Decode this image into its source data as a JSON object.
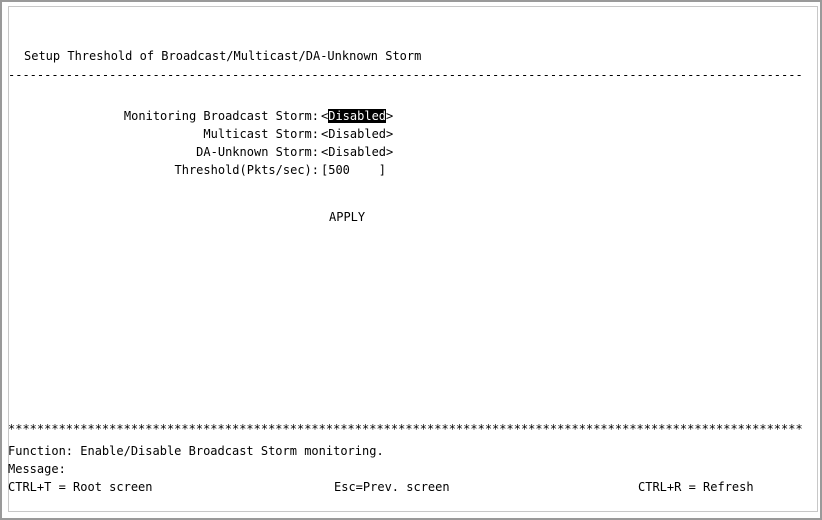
{
  "header": {
    "title": "Setup Threshold of Broadcast/Multicast/DA-Unknown Storm",
    "rule_top": "--------------------------------------------------------------------------------------------------------------"
  },
  "form": {
    "broadcast_label": "Monitoring Broadcast Storm:",
    "broadcast_value": "Disabled",
    "multicast_label": "Multicast Storm:",
    "multicast_value": "<Disabled>",
    "daunknown_label": "DA-Unknown Storm:",
    "daunknown_value": "<Disabled>",
    "threshold_label": "Threshold(Pkts/sec):",
    "threshold_value": "[500    ]",
    "apply_label": "APPLY",
    "broadcast_open": "<",
    "broadcast_close": ">"
  },
  "footer": {
    "rule_bottom": "**************************************************************************************************************",
    "function_text": "Function: Enable/Disable Broadcast Storm monitoring.",
    "message_text": "Message:",
    "root_shortcut": "CTRL+T = Root screen",
    "prev_shortcut": "Esc=Prev. screen",
    "refresh_shortcut": "CTRL+R = Refresh"
  }
}
